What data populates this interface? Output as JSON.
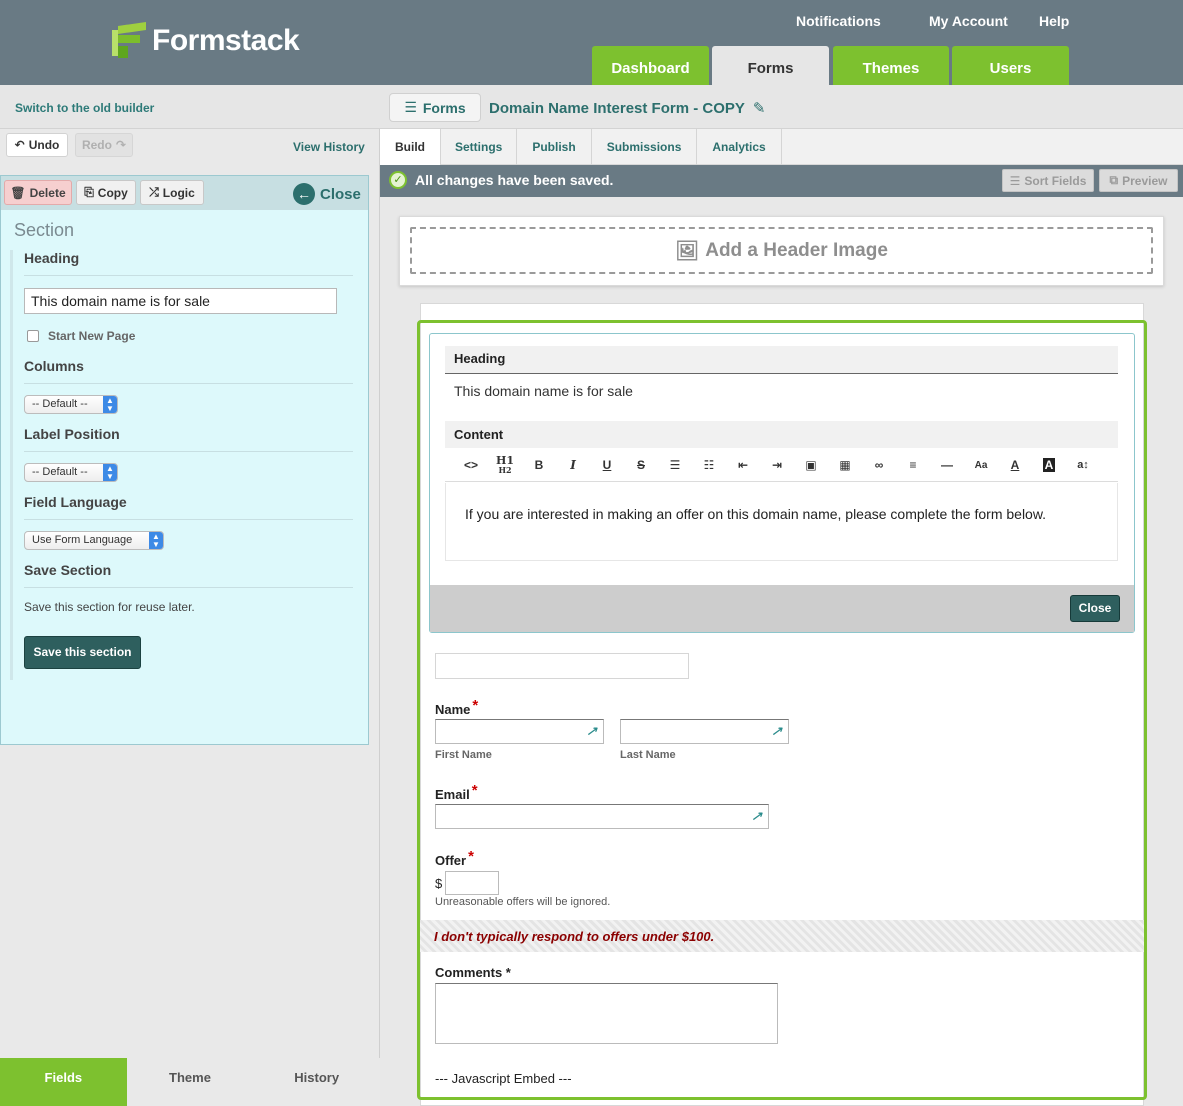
{
  "header": {
    "brand": "Formstack",
    "top_links": [
      "Notifications",
      "My Account",
      "Help"
    ],
    "main_tabs": [
      {
        "label": "Dashboard",
        "active": false
      },
      {
        "label": "Forms",
        "active": true
      },
      {
        "label": "Themes",
        "active": false
      },
      {
        "label": "Users",
        "active": false
      }
    ]
  },
  "subbar": {
    "old_builder_link": "Switch to the old builder",
    "forms_button": "Forms",
    "form_title": "Domain Name Interest Form - COPY"
  },
  "history": {
    "undo": "Undo",
    "redo": "Redo",
    "view_history": "View History"
  },
  "panel": {
    "delete": "Delete",
    "copy": "Copy",
    "logic": "Logic",
    "close": "Close",
    "section_title": "Section",
    "heading_label": "Heading",
    "heading_value": "This domain name is for sale",
    "start_new_page": "Start New Page",
    "columns_label": "Columns",
    "columns_value": "-- Default --",
    "label_position_label": "Label Position",
    "label_position_value": "-- Default --",
    "field_language_label": "Field Language",
    "field_language_value": "Use Form Language",
    "save_section_label": "Save Section",
    "save_section_desc": "Save this section for reuse later.",
    "save_section_button": "Save this section"
  },
  "bottom_tabs": [
    {
      "label": "Fields",
      "active": true
    },
    {
      "label": "Theme",
      "active": false
    },
    {
      "label": "History",
      "active": false
    }
  ],
  "sub_tabs": [
    {
      "label": "Build",
      "active": true
    },
    {
      "label": "Settings",
      "active": false
    },
    {
      "label": "Publish",
      "active": false
    },
    {
      "label": "Submissions",
      "active": false
    },
    {
      "label": "Analytics",
      "active": false
    }
  ],
  "status": {
    "message": "All changes have been saved.",
    "sort_fields": "Sort Fields",
    "preview": "Preview"
  },
  "canvas": {
    "header_image": "Add a Header Image",
    "editor": {
      "heading_label": "Heading",
      "heading_value": "This domain name is for sale",
      "content_label": "Content",
      "toolbar_icons": [
        "code-icon",
        "heading-icon",
        "bold-icon",
        "italic-icon",
        "underline-icon",
        "strikethrough-icon",
        "unordered-list-icon",
        "ordered-list-icon",
        "outdent-icon",
        "indent-icon",
        "image-icon",
        "table-icon",
        "link-icon",
        "align-icon",
        "horizontal-rule-icon",
        "font-size-icon",
        "font-color-icon",
        "background-color-icon",
        "line-height-icon"
      ],
      "content_text": "If you are interested in making an offer on this domain name, please complete the form below.",
      "close": "Close"
    },
    "form": {
      "name_label": "Name",
      "first_name": "First Name",
      "last_name": "Last Name",
      "email_label": "Email",
      "offer_label": "Offer",
      "currency": "$",
      "offer_help": "Unreasonable offers will be ignored.",
      "offer_note": "I don't typically respond to offers under $100.",
      "comments_label": "Comments *",
      "js_embed": "--- Javascript Embed ---",
      "required_mark": "*"
    }
  },
  "colors": {
    "brand_green": "#7dc12f",
    "header_gray": "#697a84",
    "teal": "#2c6f6d",
    "required_red": "#cc0000"
  }
}
